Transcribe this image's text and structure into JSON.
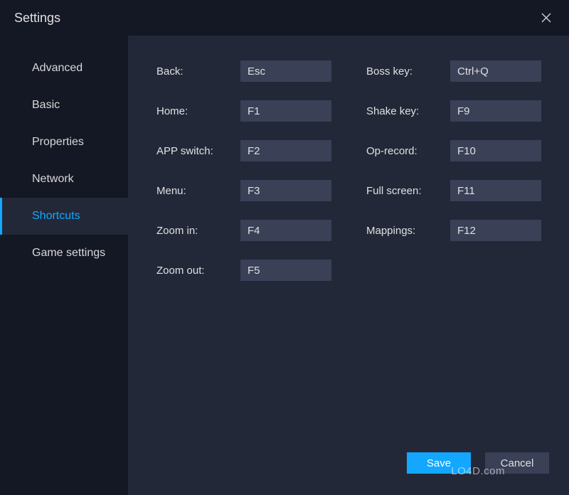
{
  "header": {
    "title": "Settings"
  },
  "sidebar": {
    "items": [
      {
        "label": "Advanced"
      },
      {
        "label": "Basic"
      },
      {
        "label": "Properties"
      },
      {
        "label": "Network"
      },
      {
        "label": "Shortcuts"
      },
      {
        "label": "Game settings"
      }
    ]
  },
  "shortcuts": {
    "left": [
      {
        "label": "Back:",
        "value": "Esc"
      },
      {
        "label": "Home:",
        "value": "F1"
      },
      {
        "label": "APP switch:",
        "value": "F2"
      },
      {
        "label": "Menu:",
        "value": "F3"
      },
      {
        "label": "Zoom in:",
        "value": "F4"
      },
      {
        "label": "Zoom out:",
        "value": "F5"
      }
    ],
    "right": [
      {
        "label": "Boss key:",
        "value": "Ctrl+Q"
      },
      {
        "label": "Shake key:",
        "value": "F9"
      },
      {
        "label": "Op-record:",
        "value": "F10"
      },
      {
        "label": "Full screen:",
        "value": "F11"
      },
      {
        "label": "Mappings:",
        "value": "F12"
      }
    ]
  },
  "buttons": {
    "save": "Save",
    "cancel": "Cancel"
  },
  "watermark": "LO4D.com"
}
